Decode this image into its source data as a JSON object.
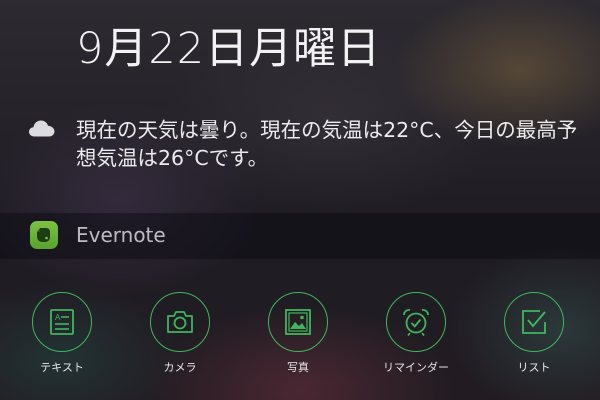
{
  "today": {
    "date": "9月22日月曜日"
  },
  "weather": {
    "icon": "cloud-icon",
    "text": "現在の天気は曇り。現在の気温は22°C、今日の最高予想気温は26°Cです。"
  },
  "widget": {
    "app_name": "Evernote",
    "app_icon": "evernote-elephant-icon",
    "accent_color": "#3fb65d",
    "actions": [
      {
        "label": "テキスト",
        "icon": "text-note-icon"
      },
      {
        "label": "カメラ",
        "icon": "camera-icon"
      },
      {
        "label": "写真",
        "icon": "photo-icon"
      },
      {
        "label": "リマインダー",
        "icon": "alarm-clock-icon"
      },
      {
        "label": "リスト",
        "icon": "checkbox-icon"
      }
    ]
  }
}
